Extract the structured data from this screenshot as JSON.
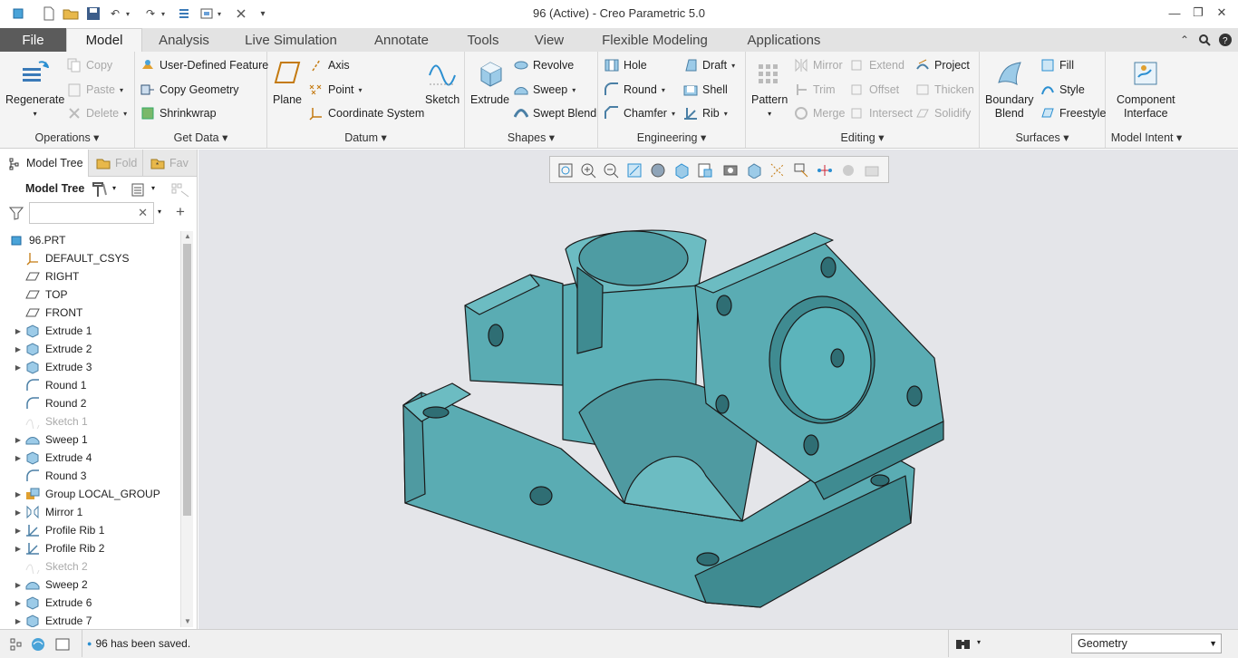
{
  "window": {
    "title": "96 (Active) - Creo Parametric 5.0",
    "minimize": "—",
    "restore": "❐",
    "close": "✕"
  },
  "menu_tabs": [
    "File",
    "Model",
    "Analysis",
    "Live Simulation",
    "Annotate",
    "Tools",
    "View",
    "Flexible Modeling",
    "Applications"
  ],
  "ribbon": {
    "operations": {
      "label": "Operations",
      "regenerate": "Regenerate",
      "copy": "Copy",
      "paste": "Paste",
      "delete": "Delete"
    },
    "get_data": {
      "label": "Get Data",
      "udf": "User-Defined Feature",
      "copy_geometry": "Copy Geometry",
      "shrinkwrap": "Shrinkwrap"
    },
    "datum": {
      "label": "Datum",
      "plane": "Plane",
      "axis": "Axis",
      "point": "Point",
      "csys": "Coordinate System",
      "sketch": "Sketch"
    },
    "shapes": {
      "label": "Shapes",
      "extrude": "Extrude",
      "revolve": "Revolve",
      "sweep": "Sweep",
      "swept_blend": "Swept Blend"
    },
    "engineering": {
      "label": "Engineering",
      "hole": "Hole",
      "round": "Round",
      "chamfer": "Chamfer",
      "draft": "Draft",
      "shell": "Shell",
      "rib": "Rib"
    },
    "editing": {
      "label": "Editing",
      "pattern": "Pattern",
      "mirror": "Mirror",
      "trim": "Trim",
      "merge": "Merge",
      "extend": "Extend",
      "offset": "Offset",
      "intersect": "Intersect",
      "project": "Project",
      "thicken": "Thicken",
      "solidify": "Solidify"
    },
    "surfaces": {
      "label": "Surfaces",
      "boundary_blend_1": "Boundary",
      "boundary_blend_2": "Blend",
      "fill": "Fill",
      "style": "Style",
      "freestyle": "Freestyle"
    },
    "model_intent": {
      "label": "Model Intent",
      "ci_1": "Component",
      "ci_2": "Interface"
    }
  },
  "panel": {
    "tabs": [
      "Model Tree",
      "Fold",
      "Fav"
    ],
    "header": "Model Tree",
    "search_value": "",
    "tree": [
      {
        "label": "96.PRT",
        "icon": "part-icon",
        "expand": false,
        "indent": 0,
        "grey": false
      },
      {
        "label": "DEFAULT_CSYS",
        "icon": "csys-icon",
        "expand": false,
        "indent": 1,
        "grey": false
      },
      {
        "label": "RIGHT",
        "icon": "plane-icon",
        "expand": false,
        "indent": 1,
        "grey": false
      },
      {
        "label": "TOP",
        "icon": "plane-icon",
        "expand": false,
        "indent": 1,
        "grey": false
      },
      {
        "label": "FRONT",
        "icon": "plane-icon",
        "expand": false,
        "indent": 1,
        "grey": false
      },
      {
        "label": "Extrude 1",
        "icon": "extrude-icon",
        "expand": true,
        "indent": 1,
        "grey": false
      },
      {
        "label": "Extrude 2",
        "icon": "extrude-icon",
        "expand": true,
        "indent": 1,
        "grey": false
      },
      {
        "label": "Extrude 3",
        "icon": "extrude-icon",
        "expand": true,
        "indent": 1,
        "grey": false
      },
      {
        "label": "Round 1",
        "icon": "round-icon",
        "expand": false,
        "indent": 1,
        "grey": false
      },
      {
        "label": "Round 2",
        "icon": "round-icon",
        "expand": false,
        "indent": 1,
        "grey": false
      },
      {
        "label": "Sketch 1",
        "icon": "sketch-icon",
        "expand": false,
        "indent": 1,
        "grey": true
      },
      {
        "label": "Sweep 1",
        "icon": "sweep-icon",
        "expand": true,
        "indent": 1,
        "grey": false
      },
      {
        "label": "Extrude 4",
        "icon": "extrude-icon",
        "expand": true,
        "indent": 1,
        "grey": false
      },
      {
        "label": "Round 3",
        "icon": "round-icon",
        "expand": false,
        "indent": 1,
        "grey": false
      },
      {
        "label": "Group LOCAL_GROUP",
        "icon": "group-icon",
        "expand": true,
        "indent": 1,
        "grey": false
      },
      {
        "label": "Mirror 1",
        "icon": "mirror-icon",
        "expand": true,
        "indent": 1,
        "grey": false
      },
      {
        "label": "Profile Rib 1",
        "icon": "rib-icon",
        "expand": true,
        "indent": 1,
        "grey": false
      },
      {
        "label": "Profile Rib 2",
        "icon": "rib-icon",
        "expand": true,
        "indent": 1,
        "grey": false
      },
      {
        "label": "Sketch 2",
        "icon": "sketch-icon",
        "expand": false,
        "indent": 1,
        "grey": true
      },
      {
        "label": "Sweep 2",
        "icon": "sweep-icon",
        "expand": true,
        "indent": 1,
        "grey": false
      },
      {
        "label": "Extrude 6",
        "icon": "extrude-icon",
        "expand": true,
        "indent": 1,
        "grey": false
      },
      {
        "label": "Extrude 7",
        "icon": "extrude-icon",
        "expand": true,
        "indent": 1,
        "grey": false
      }
    ]
  },
  "status": {
    "message": "96 has been saved.",
    "filter": "Geometry"
  },
  "colors": {
    "model": "#5aacb3",
    "model_dark": "#3d8a90",
    "viewport_bg": "#e4e5e9",
    "file_tab": "#5b5b5b"
  }
}
